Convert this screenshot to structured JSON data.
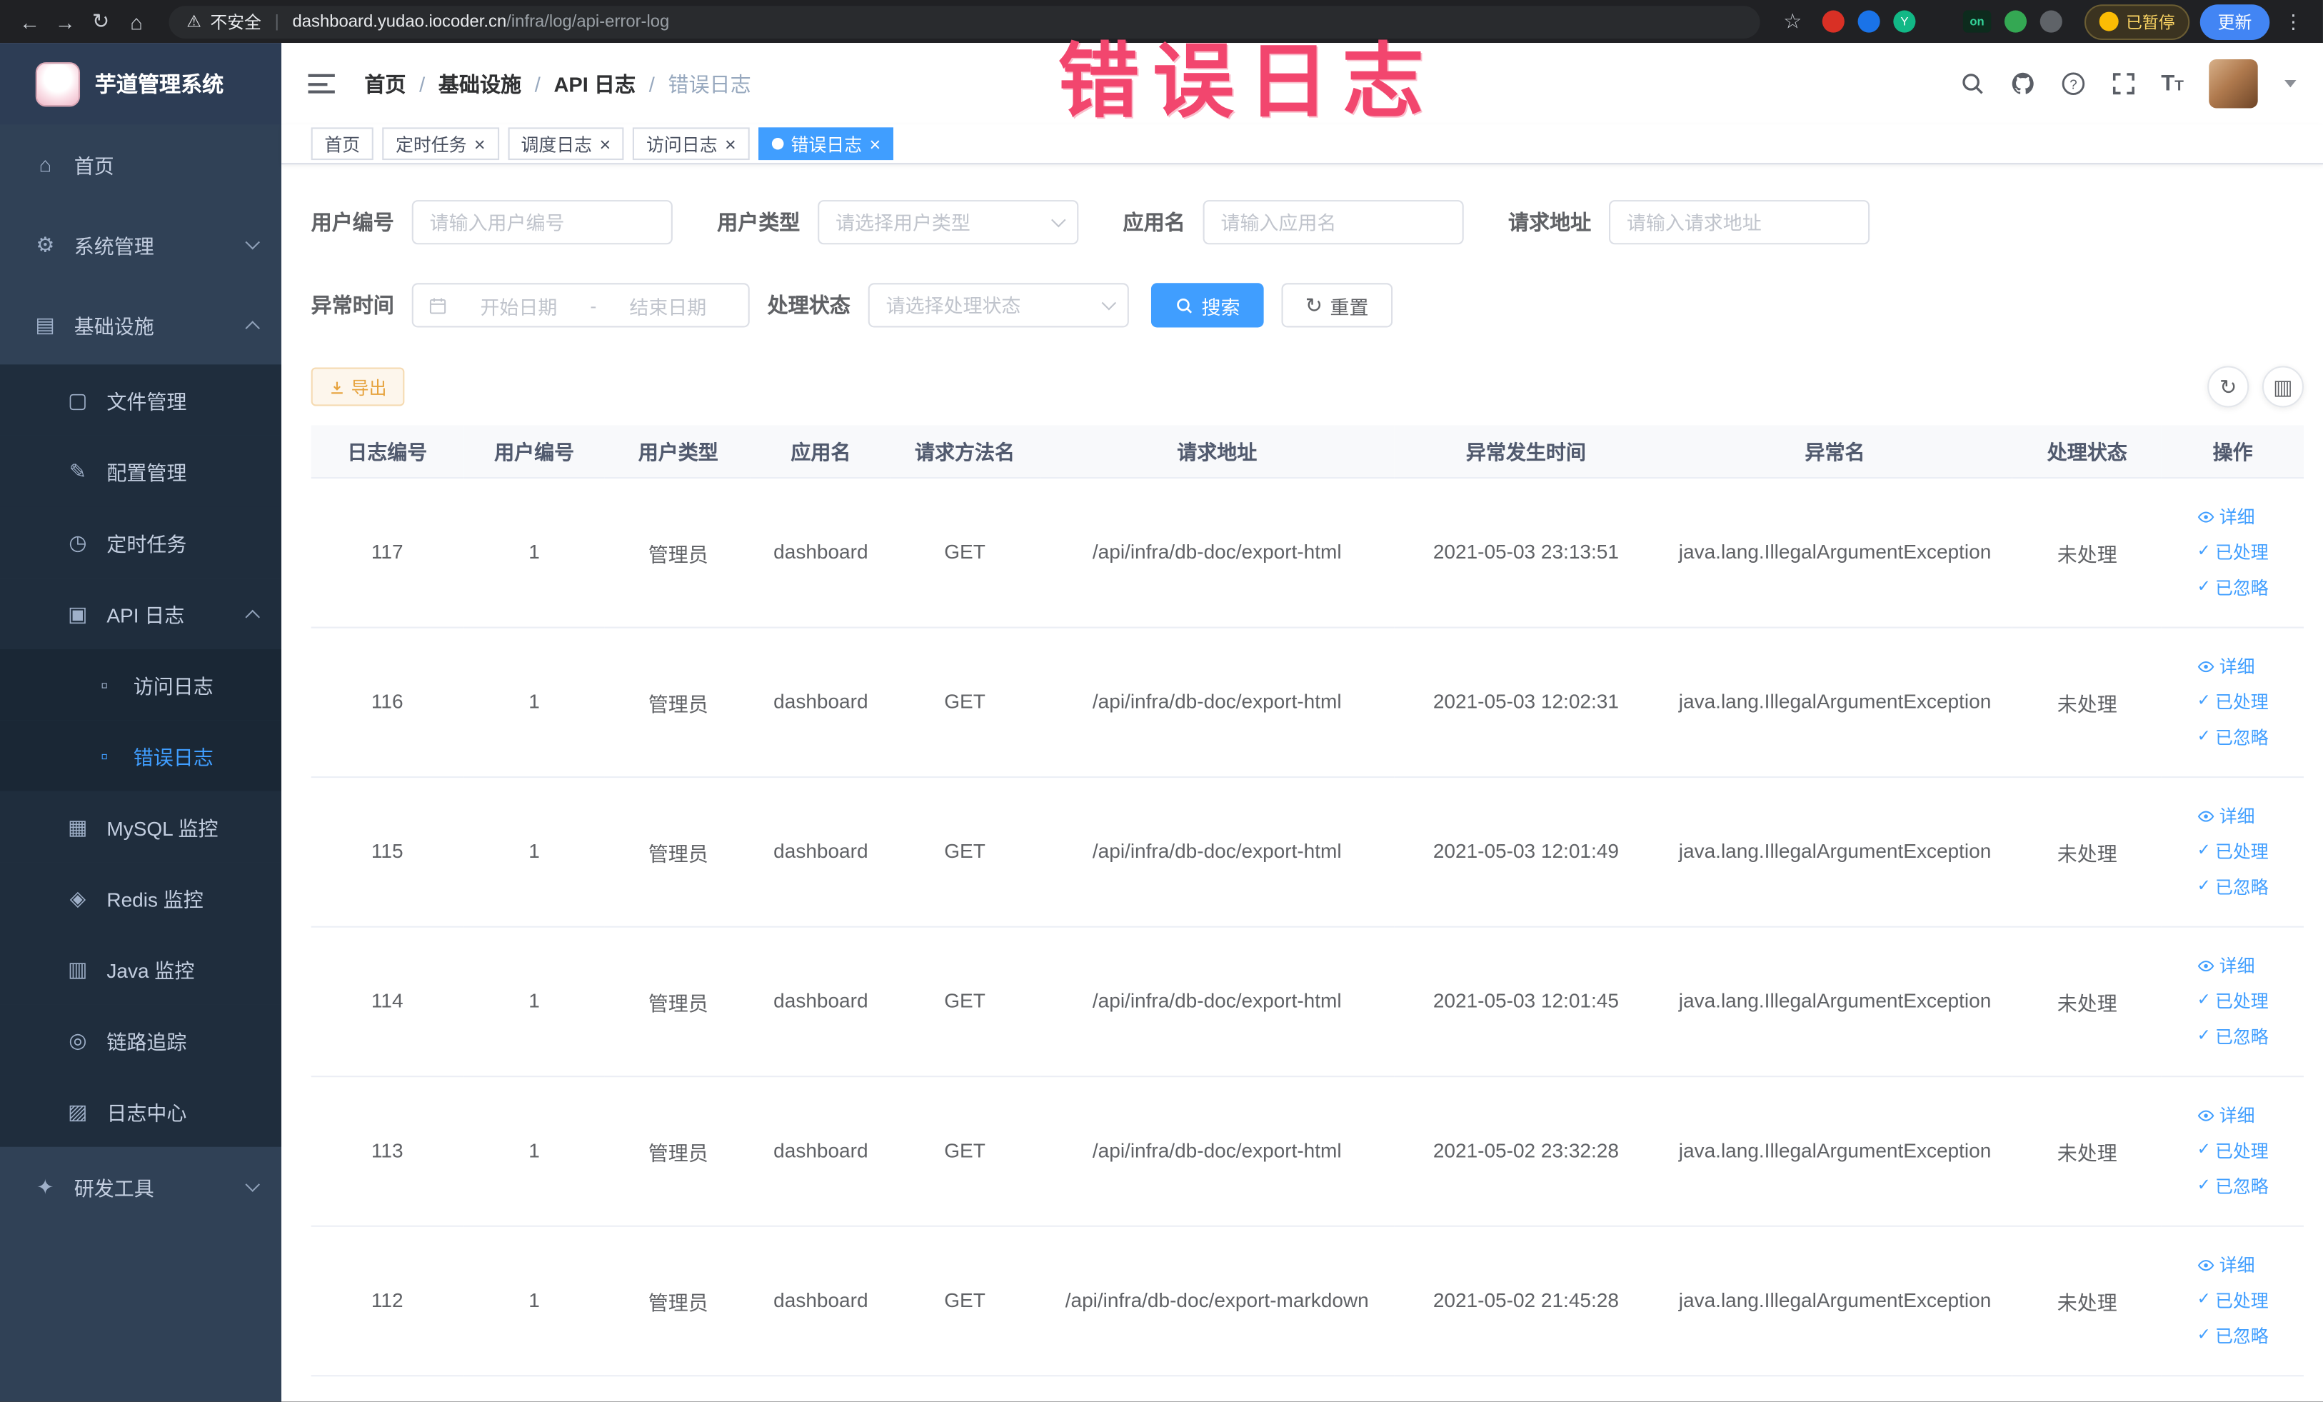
{
  "annotation": {
    "text": "错误日志",
    "color": "#f2466e"
  },
  "browser": {
    "security_text": "不安全",
    "url_domain": "dashboard.yudao.iocoder.cn",
    "url_path": "/infra/log/api-error-log",
    "paused_badge": "已暂停",
    "update_button": "更新",
    "ext_on_badge": "on",
    "ext_y_badge": "Y"
  },
  "icons": {
    "back": "←",
    "forward": "→",
    "reload": "↻",
    "home": "⌂",
    "warning": "⚠",
    "pipe": "|",
    "star": "☆",
    "dots": "⋮",
    "menu_home": "⌂",
    "menu_system": "⚙",
    "menu_infra": "▤",
    "menu_file": "▢",
    "menu_config": "✎",
    "menu_cron": "◷",
    "menu_apilog": "▣",
    "menu_doc": "▫",
    "menu_mysql": "▦",
    "menu_redis": "◈",
    "menu_java": "▥",
    "menu_trace": "◎",
    "menu_logcenter": "▨",
    "menu_devtools": "✦",
    "check": "✓",
    "close": "×",
    "refresh": "↻",
    "columns": "▥",
    "font_size_large": "T",
    "font_size_small": "T"
  },
  "sidebar": {
    "logo_title": "芋道管理系统",
    "items": [
      {
        "label": "首页",
        "level": 0
      },
      {
        "label": "系统管理",
        "level": 0,
        "expanded": false
      },
      {
        "label": "基础设施",
        "level": 0,
        "expanded": true
      },
      {
        "label": "文件管理",
        "level": 1
      },
      {
        "label": "配置管理",
        "level": 1
      },
      {
        "label": "定时任务",
        "level": 1
      },
      {
        "label": "API 日志",
        "level": 1,
        "expanded": true
      },
      {
        "label": "访问日志",
        "level": 2
      },
      {
        "label": "错误日志",
        "level": 2,
        "active": true
      },
      {
        "label": "MySQL 监控",
        "level": 1
      },
      {
        "label": "Redis 监控",
        "level": 1
      },
      {
        "label": "Java 监控",
        "level": 1
      },
      {
        "label": "链路追踪",
        "level": 1
      },
      {
        "label": "日志中心",
        "level": 1
      },
      {
        "label": "研发工具",
        "level": 0,
        "expanded": false
      }
    ]
  },
  "navbar": {
    "breadcrumb": [
      "首页",
      "基础设施",
      "API 日志",
      "错误日志"
    ],
    "separator": "/"
  },
  "tabs": [
    {
      "label": "首页",
      "closable": false,
      "active": false
    },
    {
      "label": "定时任务",
      "closable": true,
      "active": false
    },
    {
      "label": "调度日志",
      "closable": true,
      "active": false
    },
    {
      "label": "访问日志",
      "closable": true,
      "active": false
    },
    {
      "label": "错误日志",
      "closable": true,
      "active": true
    }
  ],
  "filters": {
    "user_id": {
      "label": "用户编号",
      "placeholder": "请输入用户编号"
    },
    "user_type": {
      "label": "用户类型",
      "placeholder": "请选择用户类型"
    },
    "app_name": {
      "label": "应用名",
      "placeholder": "请输入应用名"
    },
    "request_url": {
      "label": "请求地址",
      "placeholder": "请输入请求地址"
    },
    "exception_time": {
      "label": "异常时间",
      "start_placeholder": "开始日期",
      "separator": "-",
      "end_placeholder": "结束日期"
    },
    "process_status": {
      "label": "处理状态",
      "placeholder": "请选择处理状态"
    },
    "search_button": "搜索",
    "reset_button": "重置"
  },
  "toolbar": {
    "export_button": "导出"
  },
  "table": {
    "headers": [
      "日志编号",
      "用户编号",
      "用户类型",
      "应用名",
      "请求方法名",
      "请求地址",
      "异常发生时间",
      "异常名",
      "处理状态",
      "操作"
    ],
    "action_detail": "详细",
    "action_processed": "已处理",
    "action_ignored": "已忽略",
    "rows": [
      {
        "log_id": "117",
        "user_id": "1",
        "user_type": "管理员",
        "app_name": "dashboard",
        "method": "GET",
        "url": "/api/infra/db-doc/export-html",
        "time": "2021-05-03 23:13:51",
        "exception": "java.lang.IllegalArgumentException",
        "status": "未处理"
      },
      {
        "log_id": "116",
        "user_id": "1",
        "user_type": "管理员",
        "app_name": "dashboard",
        "method": "GET",
        "url": "/api/infra/db-doc/export-html",
        "time": "2021-05-03 12:02:31",
        "exception": "java.lang.IllegalArgumentException",
        "status": "未处理"
      },
      {
        "log_id": "115",
        "user_id": "1",
        "user_type": "管理员",
        "app_name": "dashboard",
        "method": "GET",
        "url": "/api/infra/db-doc/export-html",
        "time": "2021-05-03 12:01:49",
        "exception": "java.lang.IllegalArgumentException",
        "status": "未处理"
      },
      {
        "log_id": "114",
        "user_id": "1",
        "user_type": "管理员",
        "app_name": "dashboard",
        "method": "GET",
        "url": "/api/infra/db-doc/export-html",
        "time": "2021-05-03 12:01:45",
        "exception": "java.lang.IllegalArgumentException",
        "status": "未处理"
      },
      {
        "log_id": "113",
        "user_id": "1",
        "user_type": "管理员",
        "app_name": "dashboard",
        "method": "GET",
        "url": "/api/infra/db-doc/export-html",
        "time": "2021-05-02 23:32:28",
        "exception": "java.lang.IllegalArgumentException",
        "status": "未处理"
      },
      {
        "log_id": "112",
        "user_id": "1",
        "user_type": "管理员",
        "app_name": "dashboard",
        "method": "GET",
        "url": "/api/infra/db-doc/export-markdown",
        "time": "2021-05-02 21:45:28",
        "exception": "java.lang.IllegalArgumentException",
        "status": "未处理"
      }
    ]
  },
  "colors": {
    "accent": "#409eff",
    "sidebar_bg": "#304156",
    "submenu_bg": "#1f2d3d",
    "submenu2_bg": "#1a2735",
    "warning_text": "#e6a23c",
    "warning_bg": "#fdf6ec",
    "annotation": "#f2466e"
  }
}
